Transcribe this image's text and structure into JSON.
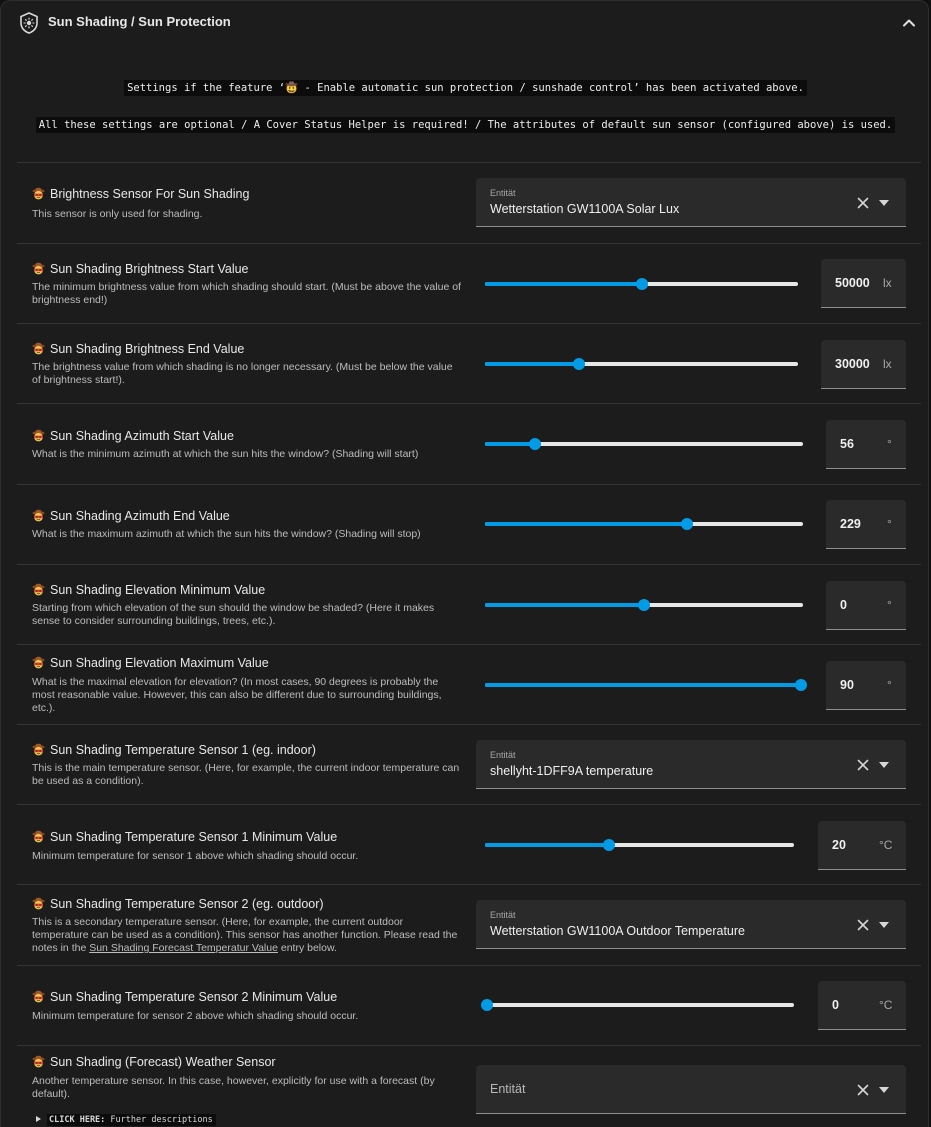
{
  "header": {
    "title": "Sun Shading / Sun Protection",
    "icon": "shield-sun-icon",
    "collapse_icon": "chevron-up-icon"
  },
  "notices": [
    "Settings if the feature ‘🤠 - Enable automatic sun protection / sunshade control’ has been activated above.",
    "All these settings are optional / A Cover Status Helper is required! / The attributes of default sun sensor (configured above) is used."
  ],
  "rows": {
    "brightness_sensor": {
      "title": "Brightness Sensor For Sun Shading",
      "desc": "This sensor is only used for shading.",
      "select_label": "Entität",
      "select_value": "Wetterstation GW1100A Solar Lux"
    },
    "brightness_start": {
      "title": "Sun Shading Brightness Start Value",
      "desc": "The minimum brightness value from which shading should start. (Must be above the value of brightness end!)",
      "value": "50000",
      "unit": "lx",
      "fraction": 0.5
    },
    "brightness_end": {
      "title": "Sun Shading Brightness End Value",
      "desc": "The brightness value from which shading is no longer necessary. (Must be below the value of brightness start!).",
      "value": "30000",
      "unit": "lx",
      "fraction": 0.3
    },
    "azimuth_start": {
      "title": "Sun Shading Azimuth Start Value",
      "desc": "What is the minimum azimuth at which the sun hits the window? (Shading will start)",
      "value": "56",
      "unit": "°",
      "fraction": 0.156
    },
    "azimuth_end": {
      "title": "Sun Shading Azimuth End Value",
      "desc": "What is the maximum azimuth at which the sun hits the window? (Shading will stop)",
      "value": "229",
      "unit": "°",
      "fraction": 0.636
    },
    "elevation_min": {
      "title": "Sun Shading Elevation Minimum Value",
      "desc": "Starting from which elevation of the sun should the window be shaded? (Here it makes sense to consider surrounding buildings, trees, etc.).",
      "value": "0",
      "unit": "°",
      "fraction": 0.5
    },
    "elevation_max": {
      "title": "Sun Shading Elevation Maximum Value",
      "desc": "What is the maximal elevation for elevation? (In most cases, 90 degrees is probably the most reasonable value. However, this can also be different due to surrounding buildings, etc.).",
      "value": "90",
      "unit": "°",
      "fraction": 1.0
    },
    "temp_sensor_1": {
      "title": "Sun Shading Temperature Sensor 1 (eg. indoor)",
      "desc": "This is the main temperature sensor. (Here, for example, the current indoor temperature can be used as a condition).",
      "select_label": "Entität",
      "select_value": "shellyht-1DFF9A temperature"
    },
    "temp_1_min": {
      "title": "Sun Shading Temperature Sensor 1 Minimum Value",
      "desc": "Minimum temperature for sensor 1 above which shading should occur.",
      "value": "20",
      "unit": "°C",
      "fraction": 0.4
    },
    "temp_sensor_2": {
      "title": "Sun Shading Temperature Sensor 2 (eg. outdoor)",
      "desc_before": "This is a secondary temperature sensor. (Here, for example, the current outdoor temperature can be used as a condition). This sensor has another function. Please read the notes in the ",
      "desc_link": "Sun Shading Forecast Temperatur Value",
      "desc_after": " entry below.",
      "select_label": "Entität",
      "select_value": "Wetterstation GW1100A Outdoor Temperature"
    },
    "temp_2_min": {
      "title": "Sun Shading Temperature Sensor 2 Minimum Value",
      "desc": "Minimum temperature for sensor 2 above which shading should occur.",
      "value": "0",
      "unit": "°C",
      "fraction": 0.0
    },
    "forecast_sensor": {
      "title": "Sun Shading (Forecast) Weather Sensor",
      "desc": "Another temperature sensor. In this case, however, explicitly for use with a forecast (by default).",
      "select_placeholder": "Entität",
      "details_bold": "CLICK HERE:",
      "details_rest": " Further descriptions"
    }
  },
  "colors": {
    "accent": "#039be5",
    "panel": "#1c1c1c",
    "field": "#2a2a2a"
  }
}
